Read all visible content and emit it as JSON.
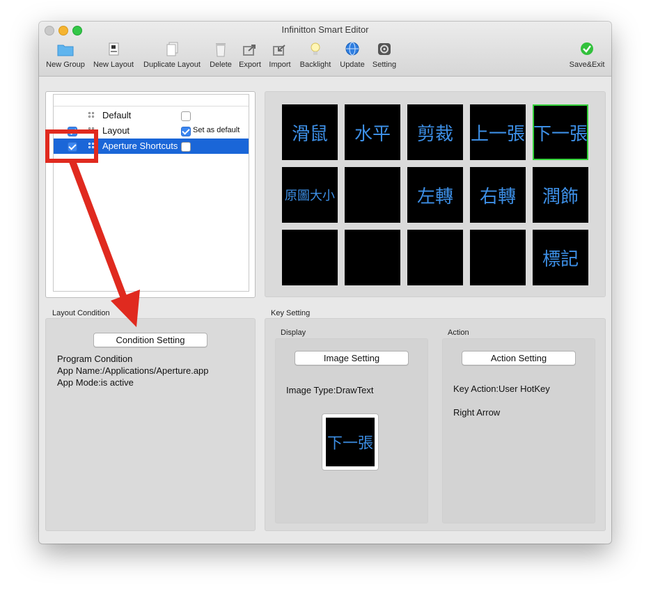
{
  "window": {
    "title": "Infinitton Smart Editor"
  },
  "toolbar": {
    "new_group": "New Group",
    "new_layout": "New Layout",
    "duplicate_layout": "Duplicate Layout",
    "delete": "Delete",
    "export": "Export",
    "import": "Import",
    "backlight": "Backlight",
    "update": "Update",
    "setting": "Setting",
    "save_exit": "Save&Exit"
  },
  "layouts": [
    {
      "label": "Default",
      "checked": false,
      "default_checked": false
    },
    {
      "label": "Layout",
      "checked": true,
      "default_checked": true,
      "default_label": "Set as default"
    },
    {
      "label": "Aperture Shortcuts",
      "checked": true,
      "default_checked": false,
      "selected": true
    }
  ],
  "keys": [
    "滑鼠",
    "水平",
    "剪裁",
    "上一張",
    "下一張",
    "原圖大小",
    "",
    "左轉",
    "右轉",
    "潤飾",
    "",
    "",
    "",
    "",
    "標記"
  ],
  "layout_condition": {
    "title": "Layout Condition",
    "button": "Condition Setting",
    "lines": [
      "Program Condition",
      "App Name:/Applications/Aperture.app",
      "App Mode:is active"
    ]
  },
  "key_setting": {
    "title": "Key Setting",
    "display_title": "Display",
    "action_title": "Action",
    "image_button": "Image Setting",
    "action_button": "Action Setting",
    "image_type": "Image Type:DrawText",
    "preview_text": "下一張",
    "key_action": "Key Action:User HotKey",
    "key_detail": "Right Arrow"
  },
  "colors": {
    "selection": "#1a66d8",
    "key_text": "#3d8fe6",
    "selected_key_border": "#35d23a",
    "annotation": "#e02a1f"
  }
}
